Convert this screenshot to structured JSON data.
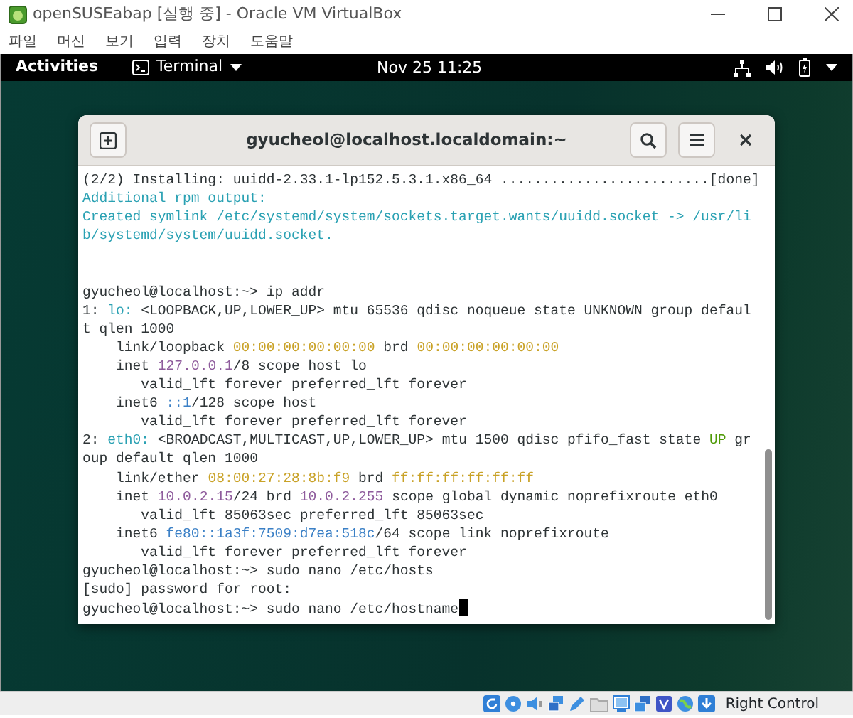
{
  "vm_window": {
    "title": "openSUSEabap [실행 중] - Oracle VM VirtualBox",
    "menu": [
      "파일",
      "머신",
      "보기",
      "입력",
      "장치",
      "도움말"
    ]
  },
  "top_bar": {
    "activities": "Activities",
    "app_menu": "Terminal",
    "clock": "Nov 25  11:25"
  },
  "terminal": {
    "title": "gyucheol@localhost.localdomain:~",
    "cursor": true,
    "lines": [
      {
        "kind": "output",
        "segments": [
          {
            "text": "(2/2) Installing: uuidd-2.33.1-lp152.5.3.1.x86_64 .........................[done]",
            "kind": "text"
          }
        ]
      },
      {
        "kind": "output",
        "segments": [
          {
            "text": "Additional rpm output:",
            "kind": "notice"
          }
        ]
      },
      {
        "kind": "output",
        "segments": [
          {
            "text": "Created symlink /etc/systemd/system/sockets.target.wants/uuidd.socket -> /usr/li",
            "kind": "notice"
          }
        ]
      },
      {
        "kind": "output",
        "segments": [
          {
            "text": "b/systemd/system/uuidd.socket.",
            "kind": "notice"
          }
        ]
      },
      {
        "kind": "blank"
      },
      {
        "kind": "blank"
      },
      {
        "kind": "output",
        "segments": [
          {
            "text": "gyucheol@localhost:~> ip addr",
            "kind": "text"
          }
        ]
      },
      {
        "kind": "output",
        "segments": [
          {
            "text": "1: ",
            "kind": "text"
          },
          {
            "text": "lo:",
            "kind": "iface"
          },
          {
            "text": " <LOOPBACK,UP,LOWER_UP> mtu 65536 qdisc noqueue state UNKNOWN group defaul",
            "kind": "text"
          }
        ]
      },
      {
        "kind": "output",
        "segments": [
          {
            "text": "t qlen 1000",
            "kind": "text"
          }
        ]
      },
      {
        "kind": "output",
        "segments": [
          {
            "text": "    link/loopback ",
            "kind": "text"
          },
          {
            "text": "00:00:00:00:00:00",
            "kind": "hwaddr"
          },
          {
            "text": " brd ",
            "kind": "text"
          },
          {
            "text": "00:00:00:00:00:00",
            "kind": "hwaddr"
          }
        ]
      },
      {
        "kind": "output",
        "segments": [
          {
            "text": "    inet ",
            "kind": "text"
          },
          {
            "text": "127.0.0.1",
            "kind": "ipv4"
          },
          {
            "text": "/8 scope host lo",
            "kind": "text"
          }
        ]
      },
      {
        "kind": "output",
        "segments": [
          {
            "text": "       valid_lft forever preferred_lft forever",
            "kind": "text"
          }
        ]
      },
      {
        "kind": "output",
        "segments": [
          {
            "text": "    inet6 ",
            "kind": "text"
          },
          {
            "text": "::1",
            "kind": "ipv6"
          },
          {
            "text": "/128 scope host",
            "kind": "text"
          }
        ]
      },
      {
        "kind": "output",
        "segments": [
          {
            "text": "       valid_lft forever preferred_lft forever",
            "kind": "text"
          }
        ]
      },
      {
        "kind": "output",
        "segments": [
          {
            "text": "2: ",
            "kind": "text"
          },
          {
            "text": "eth0:",
            "kind": "iface"
          },
          {
            "text": " <BROADCAST,MULTICAST,UP,LOWER_UP> mtu 1500 qdisc pfifo_fast state ",
            "kind": "text"
          },
          {
            "text": "UP",
            "kind": "up"
          },
          {
            "text": " gr",
            "kind": "text"
          }
        ]
      },
      {
        "kind": "output",
        "segments": [
          {
            "text": "oup default qlen 1000",
            "kind": "text"
          }
        ]
      },
      {
        "kind": "output",
        "segments": [
          {
            "text": "    link/ether ",
            "kind": "text"
          },
          {
            "text": "08:00:27:28:8b:f9",
            "kind": "hwaddr"
          },
          {
            "text": " brd ",
            "kind": "text"
          },
          {
            "text": "ff:ff:ff:ff:ff:ff",
            "kind": "hwaddr"
          }
        ]
      },
      {
        "kind": "output",
        "segments": [
          {
            "text": "    inet ",
            "kind": "text"
          },
          {
            "text": "10.0.2.15",
            "kind": "ipv4"
          },
          {
            "text": "/24 brd ",
            "kind": "text"
          },
          {
            "text": "10.0.2.255",
            "kind": "ipv4"
          },
          {
            "text": " scope global dynamic noprefixroute eth0",
            "kind": "text"
          }
        ]
      },
      {
        "kind": "output",
        "segments": [
          {
            "text": "       valid_lft 85063sec preferred_lft 85063sec",
            "kind": "text"
          }
        ]
      },
      {
        "kind": "output",
        "segments": [
          {
            "text": "    inet6 ",
            "kind": "text"
          },
          {
            "text": "fe80::1a3f:7509:d7ea:518c",
            "kind": "ipv6"
          },
          {
            "text": "/64 scope link noprefixroute",
            "kind": "text"
          }
        ]
      },
      {
        "kind": "output",
        "segments": [
          {
            "text": "       valid_lft forever preferred_lft forever",
            "kind": "text"
          }
        ]
      },
      {
        "kind": "output",
        "segments": [
          {
            "text": "gyucheol@localhost:~> sudo nano /etc/hosts",
            "kind": "text"
          }
        ]
      },
      {
        "kind": "output",
        "segments": [
          {
            "text": "[sudo] password for root:",
            "kind": "text"
          }
        ]
      },
      {
        "kind": "output",
        "segments": [
          {
            "text": "gyucheol@localhost:~> sudo nano /etc/hostname",
            "kind": "text"
          }
        ]
      }
    ]
  },
  "status_bar": {
    "host_key": "Right Control"
  }
}
